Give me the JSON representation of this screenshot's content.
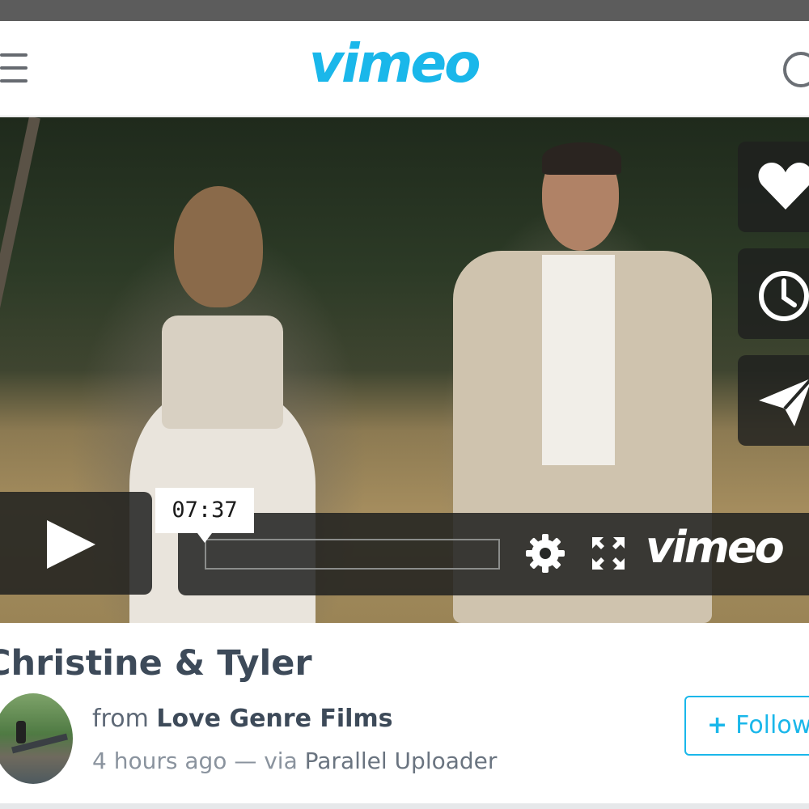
{
  "header": {
    "logo_text": "vimeo",
    "menu_icon": "hamburger-menu-icon",
    "search_icon": "search-icon"
  },
  "player": {
    "duration": "07:37",
    "progress": 0,
    "logo_text": "vimeo",
    "side_actions": [
      {
        "icon": "heart-icon"
      },
      {
        "icon": "clock-icon"
      },
      {
        "icon": "paper-plane-icon"
      }
    ],
    "controls": {
      "play_icon": "play-icon",
      "settings_icon": "gear-icon",
      "fullscreen_icon": "fullscreen-icon"
    }
  },
  "video": {
    "title": "Christine & Tyler",
    "from_prefix": "from",
    "channel": "Love Genre Films",
    "age": "4 hours ago",
    "via_separator": "— via",
    "via_app": "Parallel Uploader"
  },
  "follow": {
    "icon": "plus-icon",
    "label": "Follow"
  },
  "colors": {
    "brand": "#1ab7ea",
    "title_text": "#3d4a59",
    "status_strip": "#5c5c5c"
  }
}
